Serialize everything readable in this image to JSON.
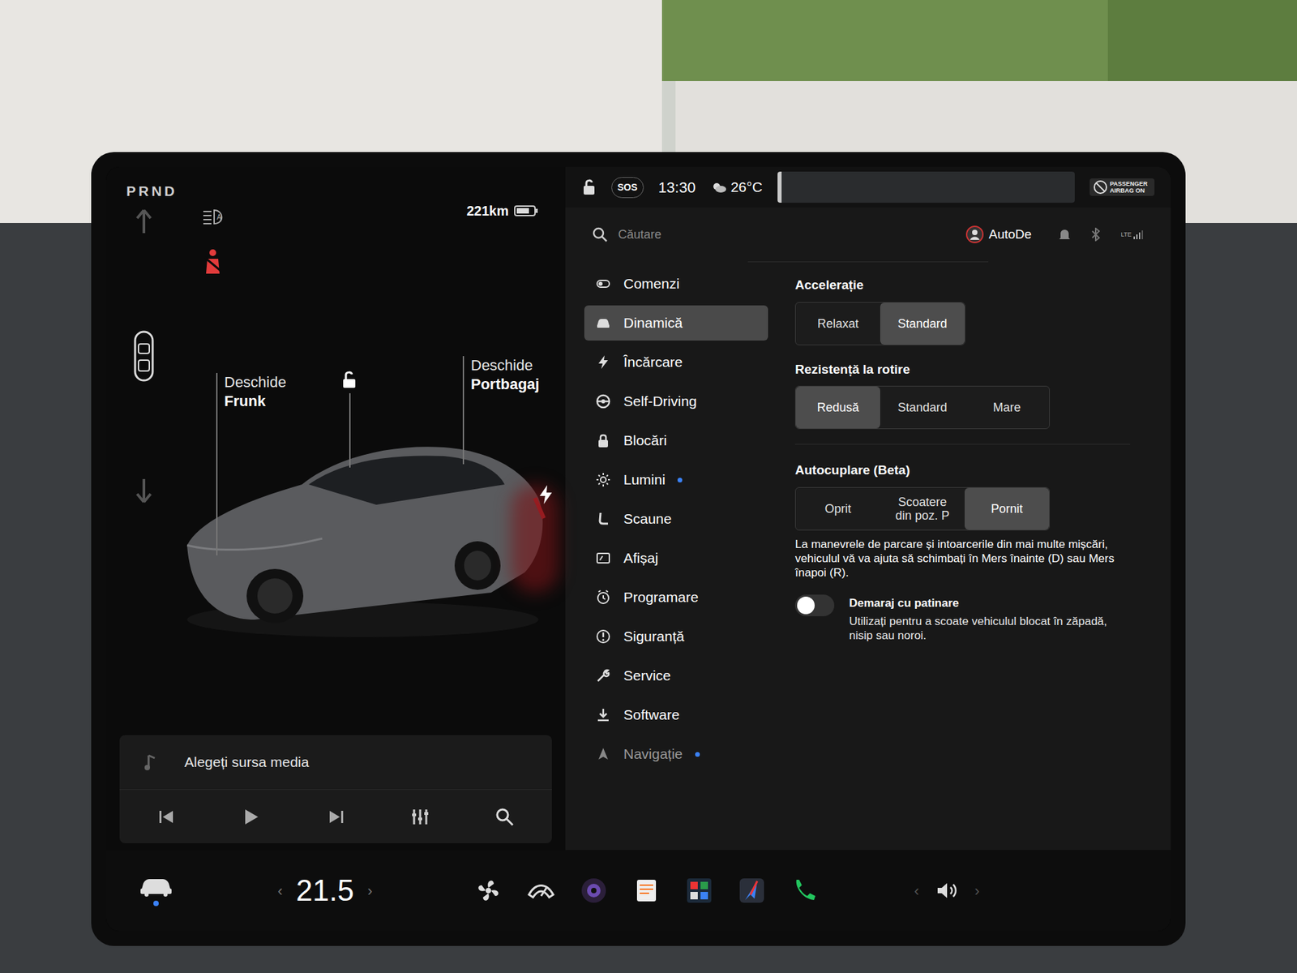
{
  "status_bar": {
    "gear": "PRND",
    "range": "221km",
    "sos": "SOS",
    "time": "13:30",
    "temperature": "26°C",
    "airbag": "PASSENGER AIRBAG ON",
    "profile": "AutoDe",
    "network": "LTE"
  },
  "car_view": {
    "frunk": {
      "line1": "Deschide",
      "line2": "Frunk"
    },
    "trunk": {
      "line1": "Deschide",
      "line2": "Portbagaj"
    }
  },
  "media": {
    "source": "Alegeți sursa media"
  },
  "search": {
    "placeholder": "Căutare"
  },
  "sidebar": {
    "items": [
      {
        "label": "Comenzi",
        "selected": false,
        "dot": false
      },
      {
        "label": "Dinamică",
        "selected": true,
        "dot": false
      },
      {
        "label": "Încărcare",
        "selected": false,
        "dot": false
      },
      {
        "label": "Self-Driving",
        "selected": false,
        "dot": false
      },
      {
        "label": "Blocări",
        "selected": false,
        "dot": false
      },
      {
        "label": "Lumini",
        "selected": false,
        "dot": true
      },
      {
        "label": "Scaune",
        "selected": false,
        "dot": false
      },
      {
        "label": "Afișaj",
        "selected": false,
        "dot": false
      },
      {
        "label": "Programare",
        "selected": false,
        "dot": false
      },
      {
        "label": "Siguranță",
        "selected": false,
        "dot": false
      },
      {
        "label": "Service",
        "selected": false,
        "dot": false
      },
      {
        "label": "Software",
        "selected": false,
        "dot": false
      },
      {
        "label": "Navigație",
        "selected": false,
        "dot": true
      }
    ]
  },
  "settings": {
    "groups": [
      {
        "title": "Accelerație",
        "options": [
          {
            "label": "Relaxat",
            "selected": false
          },
          {
            "label": "Standard",
            "selected": true
          }
        ]
      },
      {
        "title": "Rezistență la rotire",
        "options": [
          {
            "label": "Redusă",
            "selected": true
          },
          {
            "label": "Standard",
            "selected": false
          },
          {
            "label": "Mare",
            "selected": false
          }
        ]
      },
      {
        "title": "Autocuplare (Beta)",
        "options": [
          {
            "label": "Oprit",
            "selected": false
          },
          {
            "label": "Scoatere din poz. P",
            "selected": false
          },
          {
            "label": "Pornit",
            "selected": true
          }
        ],
        "description": "La manevrele de parcare și intoarcerile din mai multe mișcări, vehiculul vă va ajuta să schimbați în Mers înainte (D) sau Mers înapoi (R)."
      }
    ],
    "slip_start": {
      "title": "Demaraj cu patinare",
      "description": "Utilizați pentru a scoate vehiculul blocat în zăpadă, nisip sau noroi.",
      "on": false
    }
  },
  "climate": {
    "temperature": "21.5"
  }
}
